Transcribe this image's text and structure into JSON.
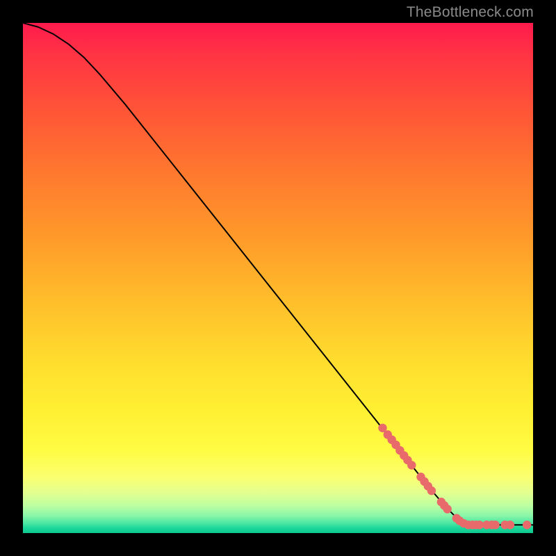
{
  "watermark": "TheBottleneck.com",
  "chart_data": {
    "type": "line",
    "title": "",
    "xlabel": "",
    "ylabel": "",
    "xlim": [
      0,
      100
    ],
    "ylim": [
      0,
      100
    ],
    "grid": false,
    "series": [
      {
        "name": "curve",
        "color": "#000000",
        "x": [
          0,
          3,
          6,
          9,
          12,
          15,
          20,
          30,
          40,
          50,
          60,
          70,
          76,
          80,
          83,
          85,
          87,
          100
        ],
        "y": [
          100,
          99.2,
          97.8,
          95.8,
          93.2,
          90,
          84.1,
          71.5,
          58.9,
          46.3,
          33.7,
          21.1,
          13.5,
          8.5,
          5,
          3,
          1.6,
          1.6
        ]
      }
    ],
    "scatter": [
      {
        "name": "dots",
        "color": "#e86a6a",
        "points": [
          {
            "x": 70.5,
            "y": 20.6
          },
          {
            "x": 71.5,
            "y": 19.3
          },
          {
            "x": 72.3,
            "y": 18.3
          },
          {
            "x": 73.1,
            "y": 17.3
          },
          {
            "x": 73.9,
            "y": 16.2
          },
          {
            "x": 74.7,
            "y": 15.2
          },
          {
            "x": 75.4,
            "y": 14.3
          },
          {
            "x": 76.2,
            "y": 13.3
          },
          {
            "x": 78.0,
            "y": 11.0
          },
          {
            "x": 78.7,
            "y": 10.1
          },
          {
            "x": 79.4,
            "y": 9.2
          },
          {
            "x": 80.1,
            "y": 8.3
          },
          {
            "x": 82.0,
            "y": 6.1
          },
          {
            "x": 82.6,
            "y": 5.4
          },
          {
            "x": 83.2,
            "y": 4.7
          },
          {
            "x": 85.0,
            "y": 2.9
          },
          {
            "x": 85.6,
            "y": 2.4
          },
          {
            "x": 86.4,
            "y": 1.9
          },
          {
            "x": 87.3,
            "y": 1.6
          },
          {
            "x": 88.1,
            "y": 1.6
          },
          {
            "x": 88.8,
            "y": 1.6
          },
          {
            "x": 89.5,
            "y": 1.6
          },
          {
            "x": 90.9,
            "y": 1.6
          },
          {
            "x": 91.9,
            "y": 1.6
          },
          {
            "x": 92.6,
            "y": 1.6
          },
          {
            "x": 94.5,
            "y": 1.6
          },
          {
            "x": 95.5,
            "y": 1.6
          },
          {
            "x": 98.8,
            "y": 1.6
          }
        ]
      }
    ]
  }
}
